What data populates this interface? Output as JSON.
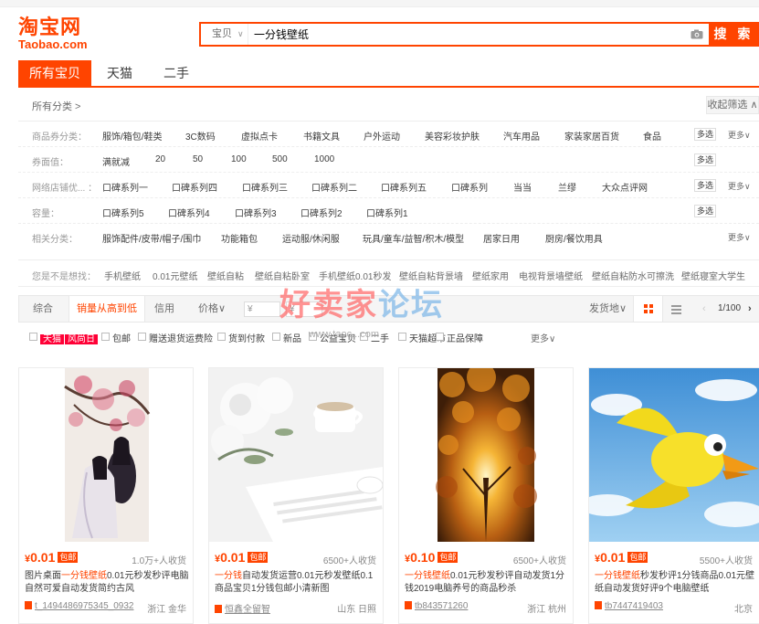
{
  "logo": {
    "cn": "淘宝网",
    "en": "Taobao.com"
  },
  "search": {
    "scope": "宝贝",
    "query": "一分钱壁纸",
    "button": "搜 索"
  },
  "tabs": [
    "所有宝贝",
    "天猫",
    "二手"
  ],
  "crumb": {
    "all": "所有分类 >",
    "collapse": "收起筛选 ∧"
  },
  "attr_rows": [
    {
      "key": "商品券分类：",
      "values": [
        "服饰/箱包/鞋类",
        "3C数码",
        "虚拟点卡",
        "书籍文具",
        "户外运动",
        "美容彩妆护肤",
        "汽车用品",
        "家装家居百货",
        "食品"
      ],
      "multi": "多选",
      "more": "更多∨"
    },
    {
      "key": "券面值：",
      "values": [
        "满就减",
        "20",
        "50",
        "100",
        "500",
        "1000"
      ],
      "multi": "多选",
      "more": ""
    },
    {
      "key": "网络店铺优... ：",
      "values": [
        "口碑系列一",
        "口碑系列四",
        "口碑系列三",
        "口碑系列二",
        "口碑系列五",
        "口碑系列",
        "当当",
        "兰缪",
        "大众点评网"
      ],
      "multi": "多选",
      "more": "更多∨"
    },
    {
      "key": "容量：",
      "values": [
        "口碑系列5",
        "口碑系列4",
        "口碑系列3",
        "口碑系列2",
        "口碑系列1"
      ],
      "multi": "多选",
      "more": ""
    },
    {
      "key": "相关分类：",
      "values": [
        "服饰配件/皮带/帽子/围巾",
        "功能箱包",
        "运动服/休闲服",
        "玩具/童车/益智/积木/模型",
        "居家日用",
        "厨房/餐饮用具"
      ],
      "multi": "",
      "more": "更多∨"
    }
  ],
  "suggest": {
    "key": "您是不是想找：",
    "values": [
      "手机壁纸",
      "0.01元壁纸",
      "壁纸自粘",
      "壁纸自粘卧室",
      "手机壁纸0.01秒发",
      "壁纸自粘背景墙",
      "壁纸家用",
      "电视背景墙壁纸",
      "壁纸自粘防水可擦洗",
      "壁纸寝室大学生"
    ]
  },
  "sort": {
    "items": [
      "综合",
      "销量从高到低",
      "信用",
      "价格∨"
    ],
    "price_from": "¥",
    "price_to": "¥",
    "ship": "发货地∨",
    "page": "1/100"
  },
  "filters": {
    "tmall": "天猫",
    "fengshangri": "风尚日",
    "items": [
      "包邮",
      "赠送退货运费险",
      "货到付款",
      "新品",
      "公益宝贝",
      "二手",
      "天猫超市",
      "正品保障"
    ],
    "more": "更多∨"
  },
  "watermark": {
    "main": "好卖家",
    "accent": "论坛",
    "sub": "www.taoc...com"
  },
  "products": [
    {
      "price": "0.01",
      "pk": "包邮",
      "sold": "1.0万+人收货",
      "title_pre": "图片桌面",
      "title_hl": "一分钱壁纸",
      "title_post": "0.01元秒发秒评电脑自然可爱自动发货简约古风",
      "shop": "t_1494486975345_0932",
      "loc": "浙江 金华"
    },
    {
      "price": "0.01",
      "pk": "包邮",
      "sold": "6500+人收货",
      "title_pre": "",
      "title_hl": "一分钱",
      "title_post": "自动发货运营0.01元秒发壁纸0.1商品宝贝1分钱包邮小清新图",
      "shop": "恒鑫全留智",
      "loc": "山东 日照"
    },
    {
      "price": "0.10",
      "pk": "包邮",
      "sold": "6500+人收货",
      "title_pre": "",
      "title_hl": "一分钱壁纸",
      "title_post": "0.01元秒发秒评自动发货1分钱2019电脑养号的商品秒杀",
      "shop": "tb843571260",
      "loc": "浙江 杭州"
    },
    {
      "price": "0.01",
      "pk": "包邮",
      "sold": "5500+人收货",
      "title_pre": "",
      "title_hl": "一分钱壁纸",
      "title_post": "秒发秒评1分钱商品0.01元壁纸自动发货好评9个电脑壁纸",
      "shop": "tb7447419403",
      "loc": "北京"
    }
  ]
}
